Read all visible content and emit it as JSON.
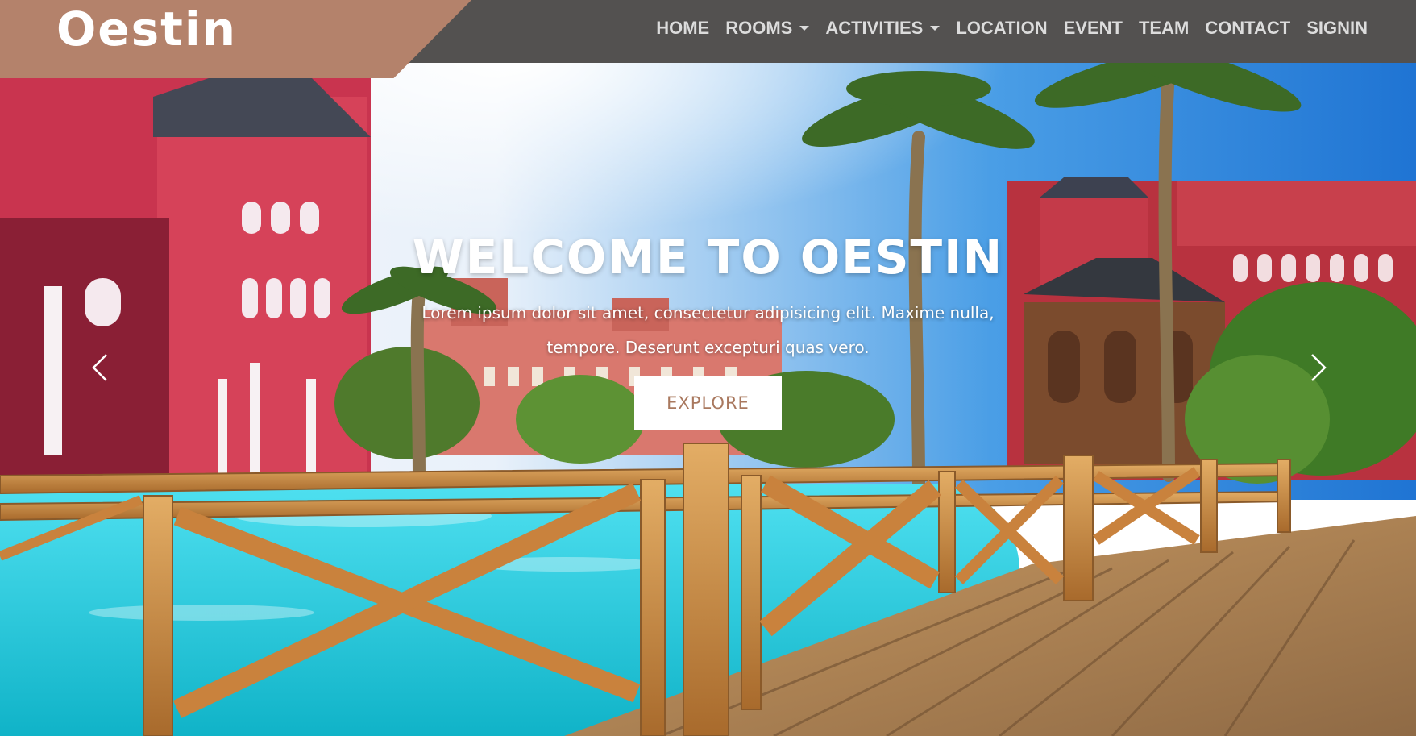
{
  "brand": {
    "name": "Oestin"
  },
  "nav": {
    "items": [
      {
        "label": "HOME",
        "dropdown": false
      },
      {
        "label": "ROOMS",
        "dropdown": true
      },
      {
        "label": "ACTIVITIES",
        "dropdown": true
      },
      {
        "label": "LOCATION",
        "dropdown": false
      },
      {
        "label": "EVENT",
        "dropdown": false
      },
      {
        "label": "TEAM",
        "dropdown": false
      },
      {
        "label": "CONTACT",
        "dropdown": false
      },
      {
        "label": "SIGNIN",
        "dropdown": false
      }
    ]
  },
  "hero": {
    "title": "WELCOME TO OESTIN",
    "text": "Lorem ipsum dolor sit amet, consectetur adipisicing elit. Maxime nulla, tempore. Deserunt excepturi quas vero.",
    "button_label": "EXPLORE",
    "prev_icon": "chevron-left-icon",
    "next_icon": "chevron-right-icon"
  },
  "colors": {
    "navbar": "#535150",
    "brand_bar": "#b4826b",
    "nav_text": "#dcdcdc",
    "button_text": "#a9785e"
  }
}
